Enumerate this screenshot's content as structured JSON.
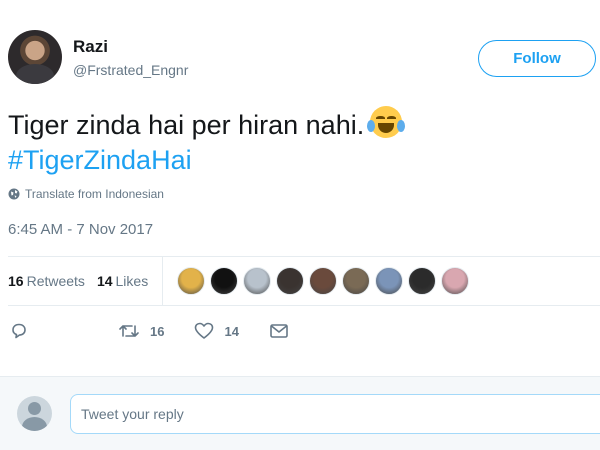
{
  "author": {
    "display_name": "Razi",
    "handle": "@Frstrated_Engnr"
  },
  "follow_button": {
    "label": "Follow"
  },
  "tweet": {
    "text": "Tiger zinda hai per hiran nahi.",
    "emoji": "face-with-tears-of-joy",
    "hashtag": "#TigerZindaHai",
    "translate_label": "Translate from Indonesian",
    "timestamp": "6:45 AM - 7 Nov 2017"
  },
  "stats": {
    "retweets_count": "16",
    "retweets_label": "Retweets",
    "likes_count": "14",
    "likes_label": "Likes",
    "liker_avatars": [
      "#e2b24a",
      "#111111",
      "#b8c2cc",
      "#3a3330",
      "#6a4a3c",
      "#7a6a55",
      "#7b94b8",
      "#2b2b2b",
      "#d9a7b0"
    ]
  },
  "actions": {
    "reply_count": "",
    "retweet_count": "16",
    "like_count": "14"
  },
  "reply": {
    "placeholder": "Tweet your reply"
  },
  "colors": {
    "accent": "#1da1f2",
    "secondary_text": "#657786",
    "border": "#e6ecf0"
  }
}
